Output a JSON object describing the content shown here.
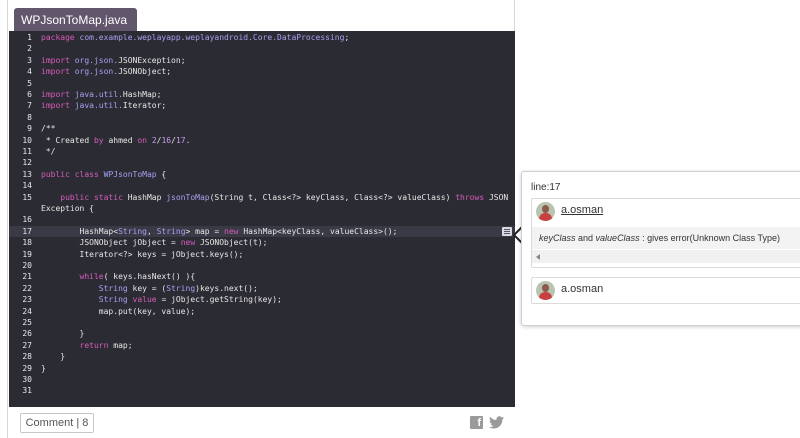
{
  "file_tab": {
    "title": "WPJsonToMap.java"
  },
  "code": {
    "lines": [
      {
        "n": "1",
        "s": [
          {
            "c": "kw",
            "t": "package "
          },
          {
            "c": "ty",
            "t": "com.example.weplayapp.weplayandroid.Core.DataProcessing"
          },
          {
            "t": ";"
          }
        ]
      },
      {
        "n": "2",
        "s": []
      },
      {
        "n": "3",
        "s": [
          {
            "c": "kw",
            "t": "import "
          },
          {
            "c": "ty",
            "t": "org.json."
          },
          {
            "t": "JSONException;"
          }
        ]
      },
      {
        "n": "4",
        "s": [
          {
            "c": "kw",
            "t": "import "
          },
          {
            "c": "ty",
            "t": "org.json."
          },
          {
            "t": "JSONObject;"
          }
        ]
      },
      {
        "n": "5",
        "s": []
      },
      {
        "n": "6",
        "s": [
          {
            "c": "kw",
            "t": "import "
          },
          {
            "c": "ty",
            "t": "java.util."
          },
          {
            "t": "HashMap;"
          }
        ]
      },
      {
        "n": "7",
        "s": [
          {
            "c": "kw",
            "t": "import "
          },
          {
            "c": "ty",
            "t": "java.util."
          },
          {
            "t": "Iterator;"
          }
        ]
      },
      {
        "n": "8",
        "s": []
      },
      {
        "n": "9",
        "s": [
          {
            "t": "/**"
          }
        ]
      },
      {
        "n": "10",
        "s": [
          {
            "t": " * Created "
          },
          {
            "c": "kw",
            "t": "by"
          },
          {
            "t": " ahmed "
          },
          {
            "c": "kw",
            "t": "on"
          },
          {
            "t": " "
          },
          {
            "c": "num",
            "t": "2"
          },
          {
            "t": "/"
          },
          {
            "c": "num",
            "t": "16"
          },
          {
            "t": "/"
          },
          {
            "c": "num",
            "t": "17"
          },
          {
            "t": "."
          }
        ]
      },
      {
        "n": "11",
        "s": [
          {
            "t": " */"
          }
        ]
      },
      {
        "n": "12",
        "s": []
      },
      {
        "n": "13",
        "s": [
          {
            "c": "kw",
            "t": "public class "
          },
          {
            "c": "fn",
            "t": "WPJsonToMap"
          },
          {
            "t": " {"
          }
        ]
      },
      {
        "n": "14",
        "s": []
      },
      {
        "n": "15",
        "s": [
          {
            "t": "    "
          },
          {
            "c": "kw",
            "t": "public static "
          },
          {
            "t": "HashMap "
          },
          {
            "c": "fn",
            "t": "jsonToMap"
          },
          {
            "t": "(String t, Class<?> keyClass, Class<?> valueClass) "
          },
          {
            "c": "kw",
            "t": "throws"
          },
          {
            "t": " JSON"
          }
        ]
      },
      {
        "n": "",
        "s": [
          {
            "t": "Exception {"
          }
        ]
      },
      {
        "n": "16",
        "s": []
      },
      {
        "n": "17",
        "s": [
          {
            "t": "        HashMap<"
          },
          {
            "c": "ty",
            "t": "String"
          },
          {
            "t": ", "
          },
          {
            "c": "ty",
            "t": "String"
          },
          {
            "t": "> map = "
          },
          {
            "c": "kw",
            "t": "new"
          },
          {
            "t": " HashMap<keyClass, valueClass>();"
          }
        ]
      },
      {
        "n": "18",
        "s": [
          {
            "t": "        JSONObject jObject = "
          },
          {
            "c": "kw",
            "t": "new"
          },
          {
            "t": " JSONObject(t);"
          }
        ]
      },
      {
        "n": "19",
        "s": [
          {
            "t": "        Iterator<?> keys = jObject.keys();"
          }
        ]
      },
      {
        "n": "20",
        "s": []
      },
      {
        "n": "21",
        "s": [
          {
            "t": "        "
          },
          {
            "c": "kw",
            "t": "while"
          },
          {
            "t": "( keys.hasNext() ){"
          }
        ]
      },
      {
        "n": "22",
        "s": [
          {
            "t": "            "
          },
          {
            "c": "ty",
            "t": "String"
          },
          {
            "t": " key = ("
          },
          {
            "c": "ty",
            "t": "String"
          },
          {
            "t": ")keys.next();"
          }
        ]
      },
      {
        "n": "23",
        "s": [
          {
            "t": "            "
          },
          {
            "c": "ty",
            "t": "String"
          },
          {
            "t": " "
          },
          {
            "c": "kw",
            "t": "value"
          },
          {
            "t": " = jObject.getString(key);"
          }
        ]
      },
      {
        "n": "24",
        "s": [
          {
            "t": "            map.put(key, value);"
          }
        ]
      },
      {
        "n": "25",
        "s": []
      },
      {
        "n": "26",
        "s": [
          {
            "t": "        }"
          }
        ]
      },
      {
        "n": "27",
        "s": [
          {
            "t": "        "
          },
          {
            "c": "kw",
            "t": "return"
          },
          {
            "t": " map;"
          }
        ]
      },
      {
        "n": "28",
        "s": [
          {
            "t": "    }"
          }
        ]
      },
      {
        "n": "29",
        "s": [
          {
            "t": "}"
          }
        ]
      },
      {
        "n": "30",
        "s": []
      },
      {
        "n": "31",
        "s": []
      }
    ]
  },
  "footer": {
    "comment_button": "Comment | 8",
    "share_icons": [
      "facebook-icon",
      "twitter-icon"
    ]
  },
  "popup": {
    "line_label": "line:17",
    "comments": [
      {
        "author": "a.osman",
        "text_parts": [
          {
            "italic": true,
            "t": "keyClass"
          },
          {
            "italic": false,
            "t": " and "
          },
          {
            "italic": true,
            "t": "valueClass"
          },
          {
            "italic": false,
            "t": " : gives error(Unknown Class Type)"
          }
        ]
      },
      {
        "author": "a.osman"
      }
    ]
  },
  "colors": {
    "tab_bg": "#62566d",
    "code_bg": "#2b2b33",
    "keyword": "#d65cb8",
    "type": "#a6a2f2",
    "number": "#c89df2"
  }
}
